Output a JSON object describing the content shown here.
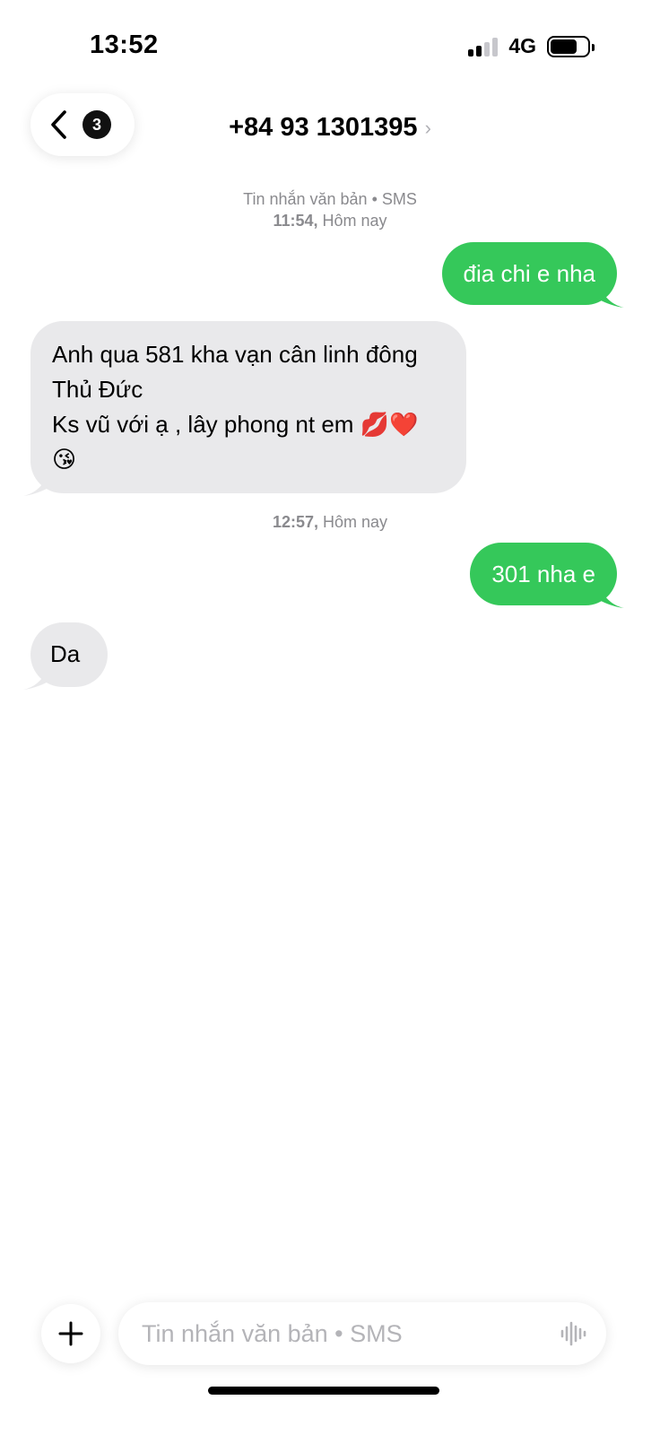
{
  "status_bar": {
    "time": "13:52",
    "network": "4G",
    "signal_bars_active": 2,
    "signal_bars_total": 4,
    "battery_level": 0.75
  },
  "header": {
    "back_badge": "3",
    "contact": "+84 93 1301395",
    "contact_chevron": "›"
  },
  "conversation": {
    "service_label": "Tin nhắn văn bản • SMS",
    "timestamps": [
      {
        "time": "11:54,",
        "day": "Hôm nay"
      },
      {
        "time": "12:57,",
        "day": "Hôm nay"
      }
    ],
    "messages": [
      {
        "direction": "sent",
        "lines": [
          "đia chi e nha"
        ]
      },
      {
        "direction": "received",
        "lines": [
          "Anh qua 581 kha vạn cân linh đông",
          "Thủ Đức",
          "Ks vũ với ạ , lây phong nt em 💋❤️",
          "😘"
        ]
      },
      {
        "direction": "sent",
        "lines": [
          "301 nha e"
        ]
      },
      {
        "direction": "received",
        "lines": [
          "Da"
        ]
      }
    ]
  },
  "composer": {
    "placeholder": "Tin nhắn văn bản • SMS",
    "value": ""
  },
  "icons": {
    "back": "chevron-left-icon",
    "add": "plus-icon",
    "audio": "waveform-icon"
  },
  "colors": {
    "sent_bubble": "#35c85a",
    "received_bubble": "#e9e9eb",
    "meta_text": "#8a8a8e",
    "badge": "#111111"
  }
}
